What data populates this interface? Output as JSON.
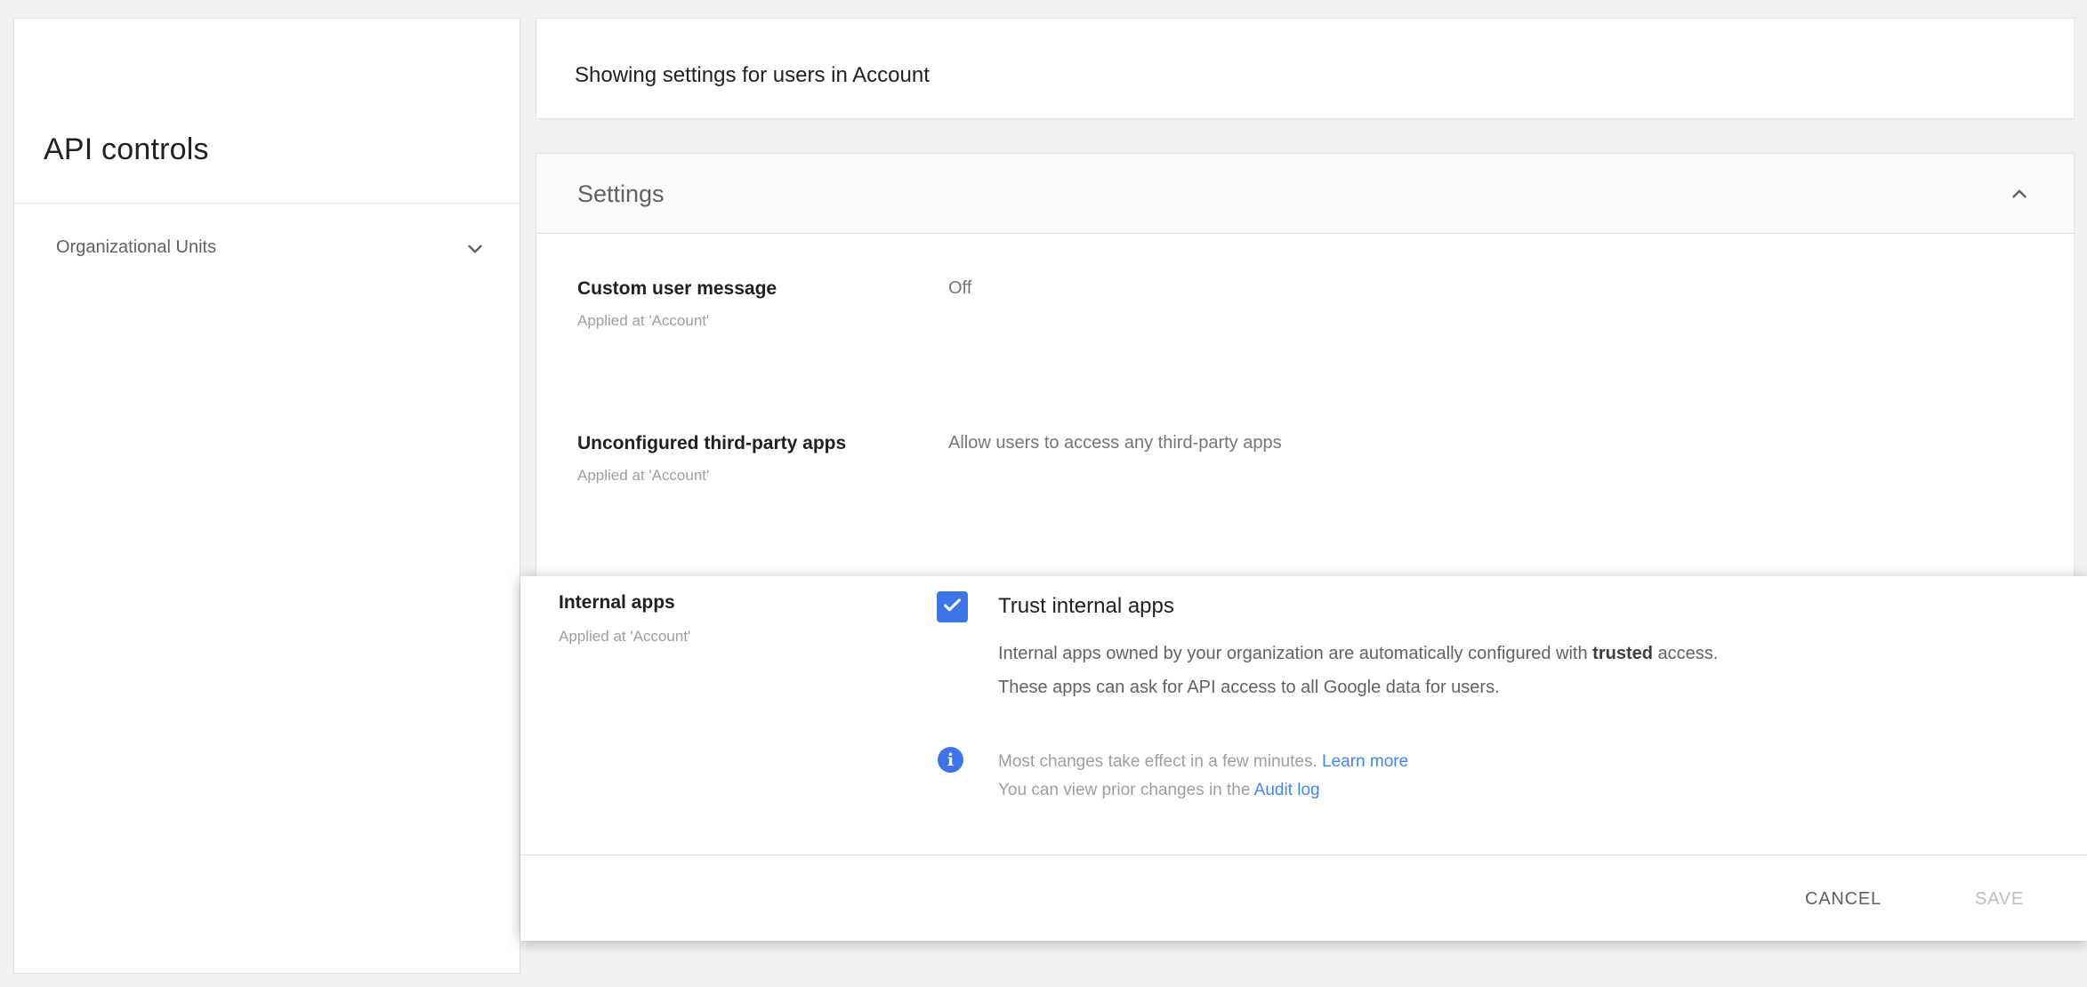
{
  "sidebar": {
    "title": "API controls",
    "nav_items": [
      {
        "label": "Organizational Units",
        "icon": "chevron-down-icon"
      }
    ]
  },
  "scope_bar": {
    "text": "Showing settings for users in Account"
  },
  "settings_card": {
    "title": "Settings",
    "collapse_icon": "chevron-up-icon",
    "rows": [
      {
        "label": "Custom user message",
        "applied_at": "Applied at 'Account'",
        "value": "Off"
      },
      {
        "label": "Unconfigured third-party apps",
        "applied_at": "Applied at 'Account'",
        "value": "Allow users to access any third-party apps"
      }
    ]
  },
  "editor_panel": {
    "label": "Internal apps",
    "applied_at": "Applied at 'Account'",
    "checkbox": {
      "checked": true,
      "label": "Trust internal apps"
    },
    "description": {
      "line1_pre": "Internal apps owned by your organization are automatically configured with ",
      "line1_bold": "trusted",
      "line1_post": " access.",
      "line2": "These apps can ask for API access to all Google data for users."
    },
    "note": {
      "icon": "info-icon",
      "line1_text": "Most changes take effect in a few minutes. ",
      "line1_link": "Learn more",
      "line2_text": "You can view prior changes in the ",
      "line2_link": "Audit log"
    },
    "buttons": {
      "cancel": "CANCEL",
      "save": "SAVE"
    }
  },
  "colors": {
    "checkbox_blue": "#3d74e8",
    "link_blue": "#4285f4",
    "card_border": "#e2e2e2",
    "page_background": "#f1f1f1"
  }
}
